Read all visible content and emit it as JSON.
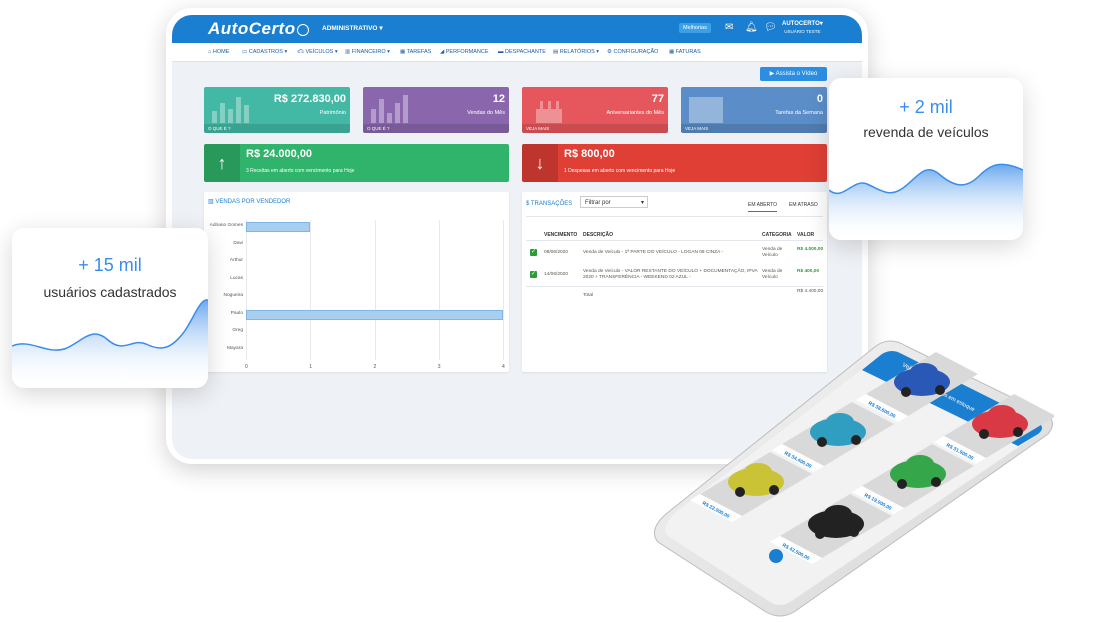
{
  "app": {
    "logo": "AutoCerto",
    "admin_menu": "ADMINISTRATIVO",
    "news_button": "Melhorias",
    "user_name": "AUTOCERTO",
    "user_role": "USUÁRIO TESTE"
  },
  "nav": [
    "HOME",
    "CADASTROS",
    "VEÍCULOS",
    "FINANCEIRO",
    "TAREFAS",
    "PERFORMANCE",
    "DESPACHANTE",
    "RELATÓRIOS",
    "CONFIGURAÇÃO",
    "FATURAS"
  ],
  "assist_button": "Assista o Vídeo",
  "stats": [
    {
      "value": "R$ 272.830,00",
      "label": "Patrimônio",
      "footer": "O QUE É ?",
      "color": "#43b9a5"
    },
    {
      "value": "12",
      "label": "Vendas do Mês",
      "footer": "O QUE É ?",
      "color": "#8a67ad"
    },
    {
      "value": "77",
      "label": "Aniversariantes do Mês",
      "footer": "VEJA MAIS",
      "color": "#e5575d"
    },
    {
      "value": "0",
      "label": "Tarefas da Semana",
      "footer": "VEJA MAIS",
      "color": "#5b8ec8"
    }
  ],
  "alerts": [
    {
      "amount": "R$ 24.000,00",
      "desc": "3 Receitas em aberto com vencimento para Hoje",
      "icon": "arrow-up",
      "color": "#30b46c"
    },
    {
      "amount": "R$ 800,00",
      "desc": "1 Despesas em aberto com vencimento para Hoje",
      "icon": "arrow-down",
      "color": "#df3f35"
    }
  ],
  "sales_panel": {
    "title": "VENDAS POR VENDEDOR",
    "chart_data": {
      "type": "bar",
      "orientation": "horizontal",
      "categories": [
        "Adriano Gomes",
        "Davi",
        "Arthur",
        "Lucas",
        "Nogueira",
        "Paulo",
        "Greg",
        "Mayara"
      ],
      "values": [
        1,
        0,
        0,
        0,
        0,
        4,
        0,
        0
      ],
      "xticks": [
        "0",
        "1",
        "2",
        "3",
        "4"
      ],
      "xlim": [
        0,
        4
      ],
      "grid": true
    }
  },
  "transactions": {
    "title": "$ TRANSAÇÕES",
    "filter_placeholder": "Filtrar por",
    "tabs": [
      "EM ABERTO",
      "EM ATRASO"
    ],
    "columns": [
      "VENCIMENTO",
      "DESCRIÇÃO",
      "CATEGORIA",
      "VALOR"
    ],
    "rows": [
      {
        "date": "08/06/2020",
        "desc": "Venda de Veículo - 1ª PARTE DO VEÍCULO - LOGAN 08 CINZA -",
        "category": "Venda de Veículo",
        "value": "R$ 4.000,00"
      },
      {
        "date": "14/06/2020",
        "desc": "Venda de Veículo - VALOR RESTANTE DO VEÍCULO + DOCUMENTAÇÃO, IPVA 2020 + TRANSFERÊNCIA - WEEKEND 02 AZUL -",
        "category": "Venda de Veículo",
        "value": "R$ 400,00"
      }
    ],
    "total_label": "Total",
    "total_value": "R$ 4.400,00"
  },
  "cards": {
    "users_big": "+ 15 mil",
    "users_sub": "usuários cadastrados",
    "resale_big": "+ 2 mil",
    "resale_sub": "revenda de veículos"
  },
  "phone": {
    "header": "Veículos",
    "subheader": "8 Veículos em estoque",
    "cars": [
      {
        "color": "#2a58b6",
        "price": "R$ 38.600,00"
      },
      {
        "color": "#2f9ec1",
        "price": "R$ 34.400,00"
      },
      {
        "color": "#c9c335",
        "price": "R$ 22.000,00"
      },
      {
        "color": "#d93945",
        "price": "R$ 31.900,00"
      },
      {
        "color": "#35a64a",
        "price": "R$ 19.000,00"
      },
      {
        "color": "#222222",
        "price": "R$ 42.500,00"
      }
    ]
  }
}
